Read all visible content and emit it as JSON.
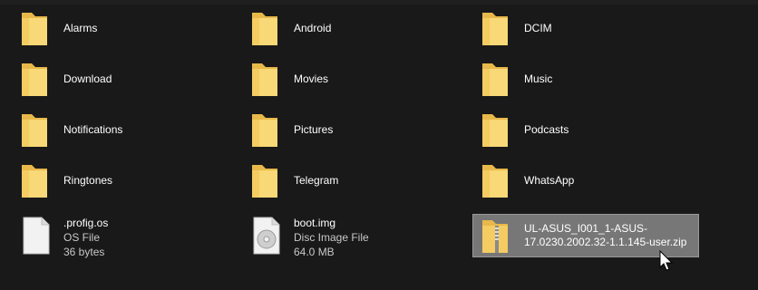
{
  "folders": [
    {
      "name": "Alarms"
    },
    {
      "name": "Android"
    },
    {
      "name": "DCIM"
    },
    {
      "name": "Download"
    },
    {
      "name": "Movies"
    },
    {
      "name": "Music"
    },
    {
      "name": "Notifications"
    },
    {
      "name": "Pictures"
    },
    {
      "name": "Podcasts"
    },
    {
      "name": "Ringtones"
    },
    {
      "name": "Telegram"
    },
    {
      "name": "WhatsApp"
    }
  ],
  "files": [
    {
      "name": ".profig.os",
      "type": "OS File",
      "size": "36 bytes",
      "icon": "blank-file-icon"
    },
    {
      "name": "boot.img",
      "type": "Disc Image File",
      "size": "64.0 MB",
      "icon": "disc-image-icon"
    },
    {
      "name": "UL-ASUS_I001_1-ASUS-17.0230.2002.32-1.1.145-user.zip",
      "icon": "zip-folder-icon",
      "selected": true
    }
  ],
  "colors": {
    "background": "#191919",
    "selection": "#777777",
    "folder": "#f4cc61",
    "text": "#ffffff",
    "meta_text": "#c8c8c8"
  }
}
